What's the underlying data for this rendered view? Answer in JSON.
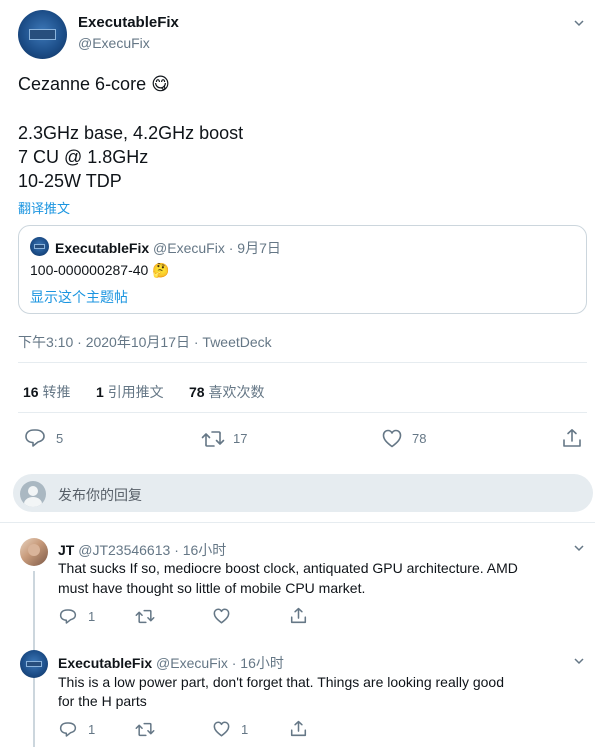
{
  "tweet": {
    "author_name": "ExecutableFix",
    "author_handle": "@ExecuFix",
    "line1": "Cezanne 6-core",
    "line1_emoji": "😋",
    "line2": "2.3GHz base, 4.2GHz boost",
    "line3": "7 CU @ 1.8GHz",
    "line4": "10-25W TDP",
    "translate_label": "翻译推文",
    "quoted": {
      "author_name": "ExecutableFix",
      "author_handle": "@ExecuFix",
      "date": "· 9月7日",
      "text": "100-000000287-40",
      "emoji": "🤔",
      "show_thread": "显示这个主题帖"
    },
    "timestamp": "下午3:10 · 2020年10月17日 · TweetDeck",
    "stats": {
      "retweets_count": "16",
      "retweets_label": "转推",
      "quotes_count": "1",
      "quotes_label": "引用推文",
      "likes_count": "78",
      "likes_label": "喜欢次数"
    },
    "actions": {
      "replies": "5",
      "retweets": "17",
      "likes": "78"
    }
  },
  "reply_box": {
    "placeholder": "发布你的回复"
  },
  "replies": [
    {
      "author_name": "JT",
      "author_handle": "@JT23546613",
      "time": "· 16小时",
      "line1": "That sucks If so, mediocre boost clock, antiquated GPU architecture. AMD",
      "line2": "must have thought so little of mobile CPU market.",
      "actions": {
        "replies": "1",
        "retweets": "",
        "likes": ""
      }
    },
    {
      "author_name": "ExecutableFix",
      "author_handle": "@ExecuFix",
      "time": "· 16小时",
      "line1": "This is a low power part, don't forget that. Things are looking really good",
      "line2": "for the H parts",
      "actions": {
        "replies": "1",
        "retweets": "",
        "likes": "1"
      }
    }
  ],
  "colors": {
    "accent": "#1b95e0",
    "muted": "#657786",
    "border": "#e6ecf0",
    "reply_box_bg": "#e6ecf0"
  }
}
